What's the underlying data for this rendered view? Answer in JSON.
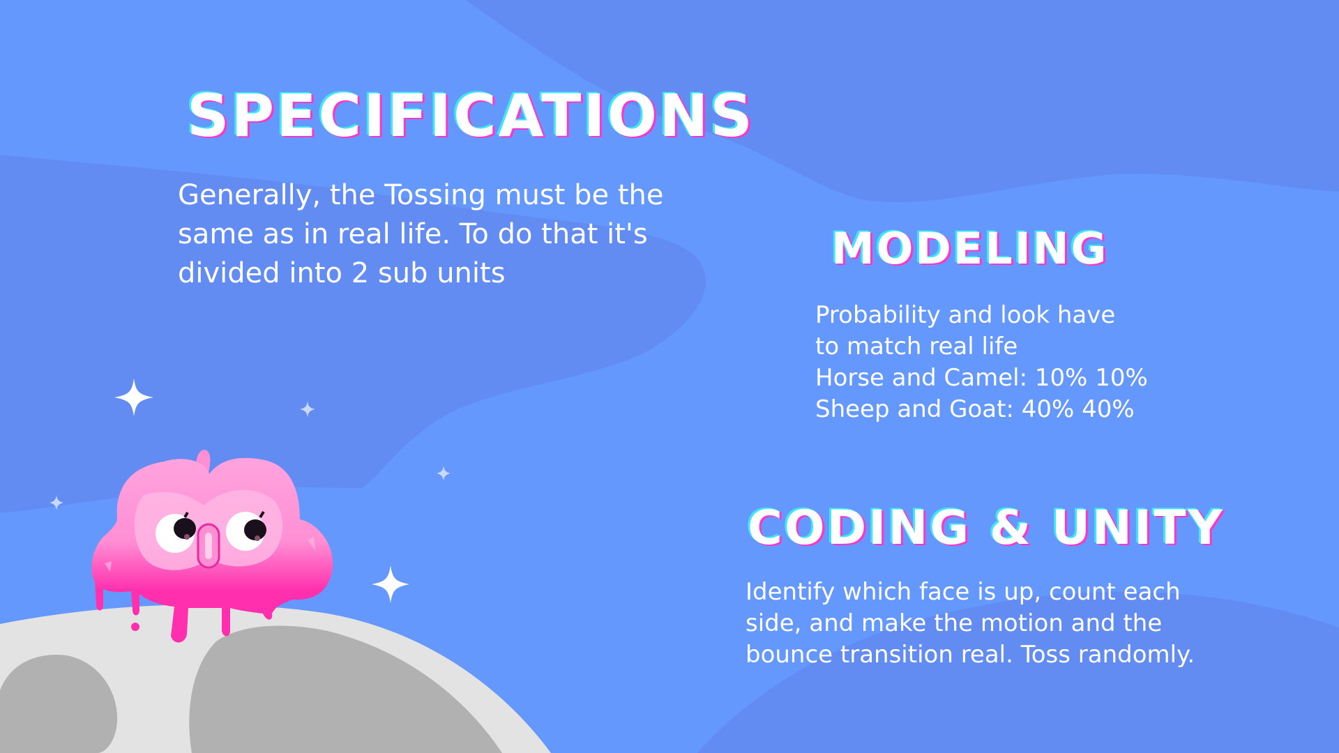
{
  "colors": {
    "background": "#6598fd",
    "wave": "#628cf1",
    "text": "#ffffff",
    "heading_shadow_cyan": "#3ee8f2",
    "heading_shadow_pink": "#ff34c8",
    "mascot_pink": "#ff2fad",
    "moon": "#e3e3e3",
    "moon_crater": "#b1b1b1"
  },
  "title": "SPECIFICATIONS",
  "intro": {
    "lines": [
      "Generally, the Tossing must be the",
      "same as in real life. To do that it's",
      "divided into 2 sub units"
    ]
  },
  "modeling": {
    "title": "MODELING",
    "lines": [
      "Probability and look have",
      "to match real life",
      "Horse and Camel: 10% 10%",
      "Sheep and Goat: 40% 40%"
    ]
  },
  "coding": {
    "title": "CODING & UNITY",
    "lines": [
      "Identify which face is up, count each",
      "side, and make the motion and the",
      "bounce transition real.  Toss randomly."
    ]
  },
  "illustration": {
    "mascot": "pink-blob-mascot",
    "planet": "moon",
    "decor": "sparkle-icon"
  }
}
